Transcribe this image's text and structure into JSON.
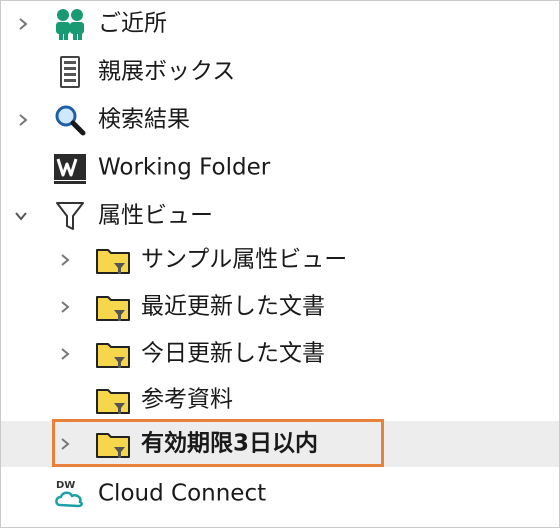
{
  "tree": {
    "nearby_label": "ご近所",
    "inbox_label": "親展ボックス",
    "search_results_label": "検索結果",
    "working_folder_label": "Working Folder",
    "attribute_view_label": "属性ビュー",
    "sample_attribute_view_label": "サンプル属性ビュー",
    "recently_updated_label": "最近更新した文書",
    "updated_today_label": "今日更新した文書",
    "reference_label": "参考資料",
    "expiring_label": "有効期限3日以内",
    "cloud_connect_label": "Cloud Connect"
  },
  "icons": {
    "nearby": "people-icon",
    "inbox": "tray-icon",
    "search_results": "magnifier-icon",
    "working_folder": "w-logo-icon",
    "attribute_view": "funnel-icon",
    "folder": "filter-folder-icon",
    "cloud_connect": "cloud-connect-icon"
  },
  "colors": {
    "highlight_border": "#e8823a",
    "folder_fill": "#f6d64a",
    "people_green": "#1a9a73",
    "selected_row": "#ededed"
  }
}
